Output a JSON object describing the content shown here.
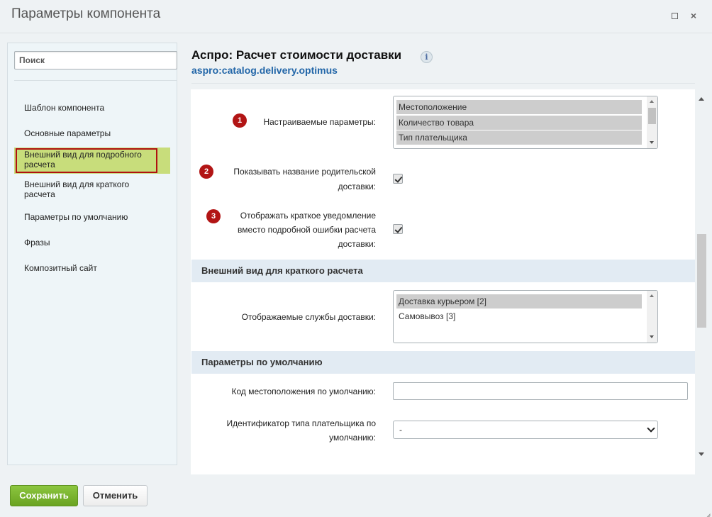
{
  "window": {
    "title": "Параметры компонента",
    "maximize_icon": "maximize-icon",
    "close_icon": "close-icon",
    "close_glyph": "×"
  },
  "sidebar": {
    "search_placeholder": "Поиск",
    "items": [
      {
        "label": "Шаблон компонента"
      },
      {
        "label": "Основные параметры"
      },
      {
        "label": "Внешний вид для подробного расчета",
        "active": true
      },
      {
        "label": "Внешний вид для краткого расчета"
      },
      {
        "label": "Параметры по умолчанию"
      },
      {
        "label": "Фразы"
      },
      {
        "label": "Композитный сайт"
      }
    ]
  },
  "component": {
    "title": "Аспро: Расчет стоимости доставки",
    "info_glyph": "i",
    "code": "aspro:catalog.delivery.optimus"
  },
  "params": {
    "custom_params": {
      "badge": "1",
      "label": "Настраиваемые параметры:",
      "options": [
        {
          "label": "Местоположение",
          "selected": true
        },
        {
          "label": "Количество товара",
          "selected": true
        },
        {
          "label": "Тип плательщика",
          "selected": true
        }
      ]
    },
    "show_parent_name": {
      "badge": "2",
      "label_line1": "Показывать название родительской",
      "label_line2": "доставки:",
      "checked": true
    },
    "short_notice": {
      "badge": "3",
      "label_line1": "Отображать краткое уведомление",
      "label_line2": "вместо подробной ошибки расчета",
      "label_line3": "доставки:",
      "checked": true
    }
  },
  "section_short": {
    "title": "Внешний вид для краткого расчета",
    "services_label": "Отображаемые службы доставки:",
    "services": [
      {
        "label": "Доставка курьером [2]",
        "selected": true
      },
      {
        "label": "Самовывоз [3]",
        "selected": false
      }
    ]
  },
  "section_defaults": {
    "title": "Параметры по умолчанию",
    "location_label": "Код местоположения по умолчанию:",
    "location_value": "",
    "payer_label_line1": "Идентификатор типа плательщика по",
    "payer_label_line2": "умолчанию:",
    "payer_value": "-"
  },
  "footer": {
    "save_label": "Сохранить",
    "cancel_label": "Отменить"
  },
  "colors": {
    "active_item": "#c8dd7b",
    "badge": "#b21515",
    "save_button": "#7ab52e",
    "link": "#2266a8",
    "section_head": "#e2ebf3"
  }
}
